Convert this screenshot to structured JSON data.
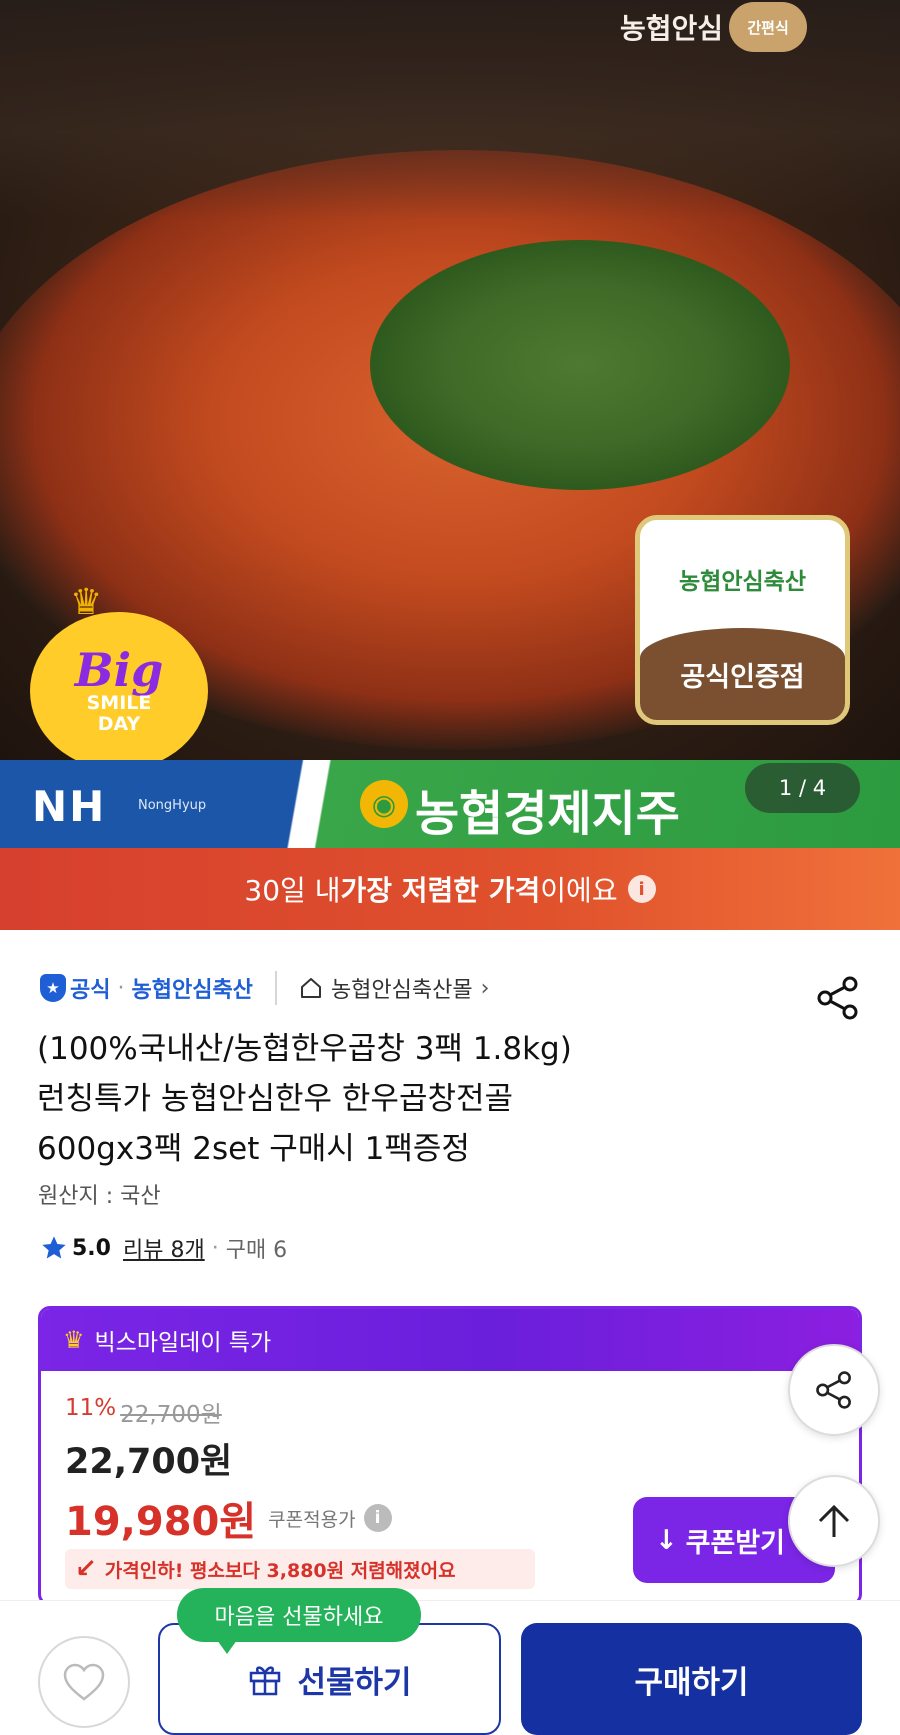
{
  "hero": {
    "brand_top": "농협안심",
    "brand_badge": "간편식",
    "cert_top": "농협안심축산",
    "cert_bottom": "공식인증점",
    "bigsmile_line1": "Big",
    "bigsmile_line2": "SMILE",
    "bigsmile_line3": "DAY",
    "nh_logo": "NH",
    "nh_sub": "NongHyup",
    "nh_title": "농협경제지주",
    "counter": "1 / 4"
  },
  "price_banner": {
    "prefix": "30일 내 ",
    "highlight": "가장 저렴한 가격",
    "suffix": "이에요"
  },
  "store": {
    "official": "공식",
    "seller": "농협안심축산",
    "mall": "농협안심축산몰"
  },
  "product": {
    "title_line1": "(100%국내산/농협한우곱창 3팩 1.8kg)",
    "title_line2": "런칭특가 농협안심한우 한우곱창전골",
    "title_line3": "600gx3팩 2set 구매시 1팩증정",
    "origin": "원산지 : 국산",
    "rating": "5.0",
    "review": "리뷰 8개",
    "buy_count": "구매 6"
  },
  "deal": {
    "header": "빅스마일데이 특가",
    "discount_pct": "11%",
    "original_price": "22,700원",
    "price": "22,700원",
    "coupon_price": "19,980원",
    "coupon_label": "쿠폰적용가",
    "drop_text": "가격인하! 평소보다 3,880원 저렴해졌어요",
    "coupon_button": "쿠폰받기"
  },
  "bottom": {
    "tooltip": "마음을 선물하세요",
    "gift_label": "선물하기",
    "buy_label": "구매하기"
  },
  "colors": {
    "accent_purple": "#7b25e6",
    "accent_red": "#d6322a",
    "brand_blue": "#1530a0",
    "tooltip_green": "#24b35a"
  }
}
